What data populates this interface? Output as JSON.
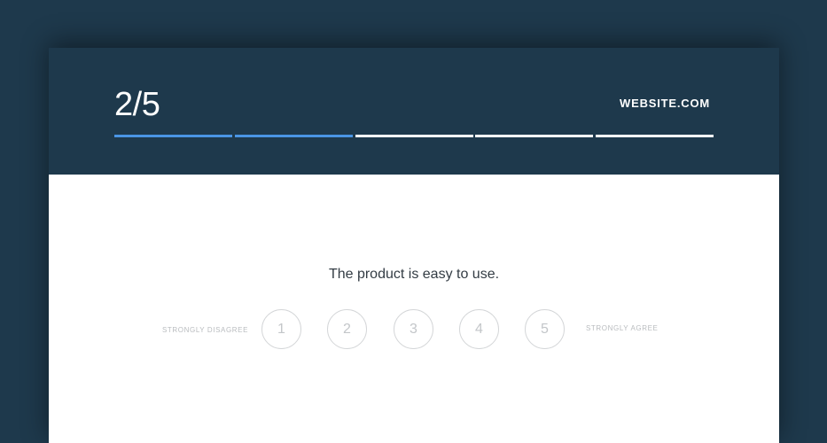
{
  "header": {
    "step_counter": "2/5",
    "brand": "WEBSITE.COM",
    "progress": {
      "total_steps": 5,
      "completed_steps": 2
    }
  },
  "question": {
    "text": "The product is easy to use.",
    "scale_min_label": "STRONGLY DISAGREE",
    "scale_max_label": "STRONGLY AGREE",
    "options": [
      "1",
      "2",
      "3",
      "4",
      "5"
    ]
  },
  "colors": {
    "background": "#1e394c",
    "progress_done": "#4a95e4",
    "progress_pending": "#ffffff",
    "card_body": "#ffffff"
  }
}
